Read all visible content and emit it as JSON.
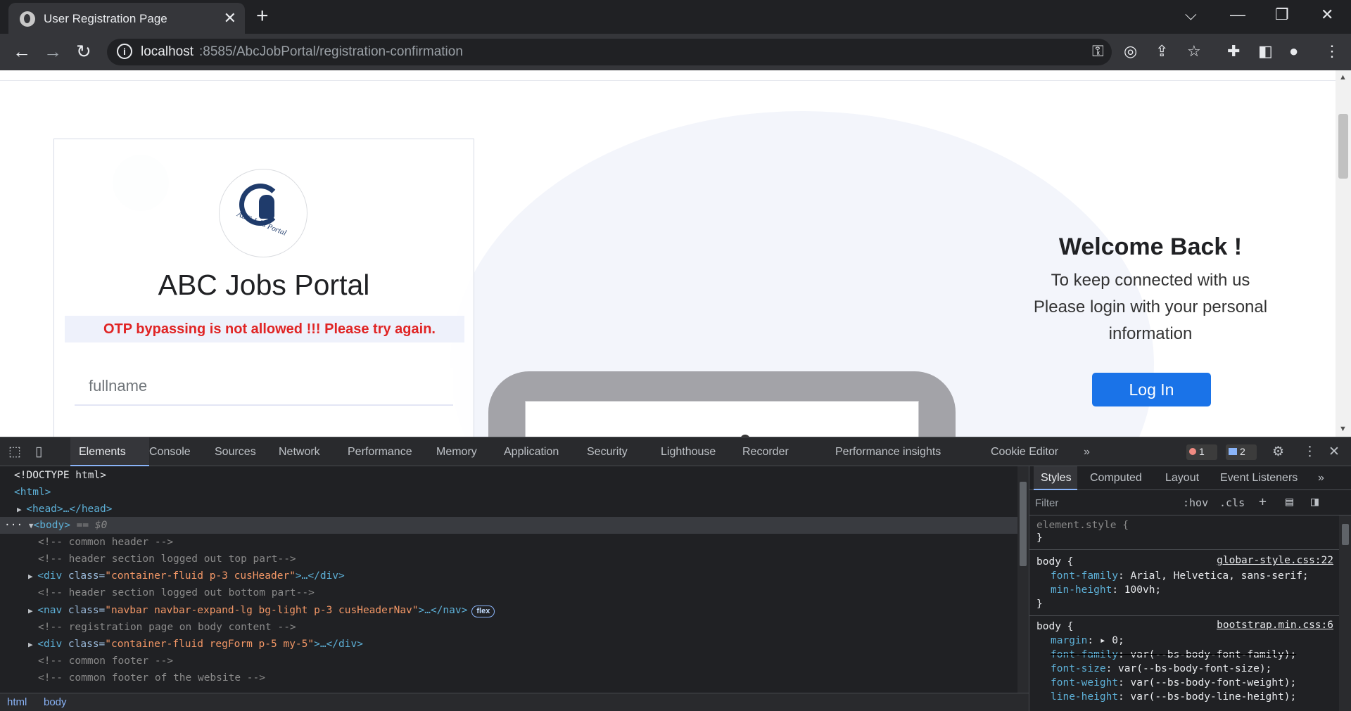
{
  "browser": {
    "tab_title": "User Registration Page",
    "tab_close": "✕",
    "new_tab": "+",
    "url_host": "localhost",
    "url_rest": ":8585/AbcJobPortal/registration-confirmation",
    "controls": {
      "tab_list": "⌵",
      "minimize": "—",
      "restore": "❐",
      "close": "✕"
    }
  },
  "page": {
    "portal_title": "ABC Jobs Portal",
    "logo_text": "ABC Jobs Portal",
    "otp_message": "OTP bypassing is not allowed !!! Please try again.",
    "fullname_placeholder": "fullname",
    "welcome_title": "Welcome Back !",
    "welcome_line1": "To keep connected with us",
    "welcome_line2": "Please login with your personal",
    "welcome_line3": "information",
    "login_button": "Log In",
    "colors": {
      "error": "#e02424",
      "primary_button": "#1a73e8"
    }
  },
  "devtools": {
    "tabs": [
      "Elements",
      "Console",
      "Sources",
      "Network",
      "Performance",
      "Memory",
      "Application",
      "Security",
      "Lighthouse",
      "Recorder",
      "Performance insights",
      "Cookie Editor"
    ],
    "more_tabs": "»",
    "error_count": "1",
    "message_count": "2",
    "dom": {
      "doctype": "<!DOCTYPE html>",
      "html_open": "<html>",
      "head": "<head>…</head>",
      "body_tag": "<body>",
      "body_eq": " == $0",
      "c_common_header": "<!-- common header -->",
      "c_header_top": "<!-- header section logged out top part-->",
      "div1_open": "<div ",
      "div1_attr": "class=",
      "div1_val": "\"container-fluid p-3 cusHeader\"",
      "div1_close": ">…</div>",
      "c_header_bottom": "<!-- header section logged out bottom part-->",
      "nav_open": "<nav ",
      "nav_attr": "class=",
      "nav_val": "\"navbar navbar-expand-lg bg-light p-3 cusHeaderNav\"",
      "nav_close": ">…</nav>",
      "flex_badge": "flex",
      "c_registration": "<!-- registration page on body content -->",
      "div2_open": "<div ",
      "div2_attr": "class=",
      "div2_val": "\"container-fluid regForm p-5 my-5\"",
      "div2_close": ">…</div>",
      "c_footer": "<!-- common footer -->",
      "c_footer_site": "<!-- common footer of the website -->"
    },
    "breadcrumb": [
      "html",
      "body"
    ],
    "styles": {
      "tabs": [
        "Styles",
        "Computed",
        "Layout",
        "Event Listeners"
      ],
      "more": "»",
      "filter_placeholder": "Filter",
      "hov": ":hov",
      "cls": ".cls",
      "element_style": "element.style {",
      "close_brace": "}",
      "rule1_selector": "body {",
      "rule1_source": "globar-style.css:22",
      "rule1_p1_name": "font-family",
      "rule1_p1_val": ": Arial, Helvetica, sans-serif;",
      "rule1_p2_name": "min-height",
      "rule1_p2_val": ": 100vh;",
      "rule2_selector": "body {",
      "rule2_source": "bootstrap.min.css:6",
      "rule2_p1_name": "margin",
      "rule2_p1_val": ": ▸ 0;",
      "rule2_p2_name": "font-family",
      "rule2_p2_val": ": var(--bs-body-font-family);",
      "rule2_p3_name": "font-size",
      "rule2_p3_val": ": var(--bs-body-font-size);",
      "rule2_p4_name": "font-weight",
      "rule2_p4_val": ": var(--bs-body-font-weight);",
      "rule2_p5_name": "line-height",
      "rule2_p5_val": ": var(--bs-body-line-height);"
    }
  }
}
